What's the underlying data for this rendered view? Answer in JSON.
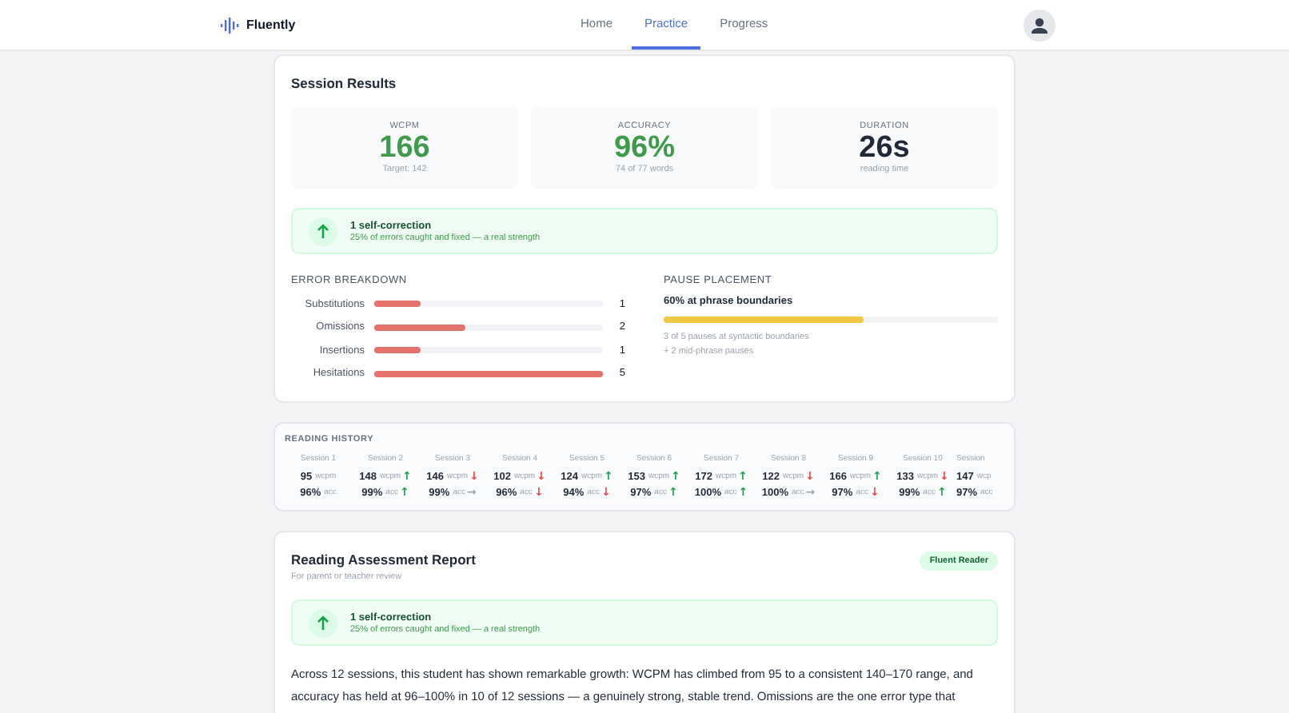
{
  "header": {
    "brand": "Fluently",
    "nav": [
      {
        "label": "Home",
        "selected": false
      },
      {
        "label": "Practice",
        "selected": true
      },
      {
        "label": "Progress",
        "selected": false
      }
    ]
  },
  "session_results": {
    "title": "Session Results",
    "stats": [
      {
        "label": "WCPM",
        "value": "166",
        "note": "Target: 142",
        "kind": "good"
      },
      {
        "label": "ACCURACY",
        "value": "96%",
        "note": "74 of 77 words",
        "kind": "good"
      },
      {
        "label": "DURATION",
        "value": "26s",
        "note": "reading time",
        "kind": "neutral"
      }
    ],
    "callout": {
      "title": "1 self-correction",
      "text": "25% of errors caught and fixed — a real strength"
    },
    "error_breakdown": {
      "title": "ERROR BREAKDOWN",
      "rows": [
        {
          "name": "Substitutions",
          "level": 0.2,
          "count": "1"
        },
        {
          "name": "Omissions",
          "level": 0.4,
          "count": "2"
        },
        {
          "name": "Insertions",
          "level": 0.2,
          "count": "1"
        },
        {
          "name": "Hesitations",
          "level": 1.0,
          "count": "5"
        }
      ]
    },
    "pause_placement": {
      "title": "PAUSE PLACEMENT",
      "headline": "60% at phrase boundaries",
      "level": 0.6,
      "notes": [
        "3 of 5 pauses at syntactic boundaries",
        "+ 2 mid-phrase pauses"
      ]
    }
  },
  "reading_history": {
    "title": "READING HISTORY",
    "sessions": [
      {
        "label": "Session 1",
        "wcpm": "95",
        "wcpm_unit": "wcpm",
        "acc": "96%",
        "acc_unit": "acc"
      },
      {
        "label": "Session 2",
        "wcpm": "148",
        "wcpm_unit": "wcpm",
        "wcpm_change": {
          "arrow": "↑",
          "color": "#16a34a"
        },
        "acc": "99%",
        "acc_unit": "acc",
        "acc_change": {
          "arrow": "↑",
          "color": "#16a34a"
        }
      },
      {
        "label": "Session 3",
        "wcpm": "146",
        "wcpm_unit": "wcpm",
        "wcpm_change": {
          "arrow": "↓",
          "color": "#ef4444"
        },
        "acc": "99%",
        "acc_unit": "acc",
        "acc_change": {
          "arrow": "→",
          "color": "#9ca3af"
        }
      },
      {
        "label": "Session 4",
        "wcpm": "102",
        "wcpm_unit": "wcpm",
        "wcpm_change": {
          "arrow": "↓",
          "color": "#ef4444"
        },
        "acc": "96%",
        "acc_unit": "acc",
        "acc_change": {
          "arrow": "↓",
          "color": "#ef4444"
        }
      },
      {
        "label": "Session 5",
        "wcpm": "124",
        "wcpm_unit": "wcpm",
        "wcpm_change": {
          "arrow": "↑",
          "color": "#16a34a"
        },
        "acc": "94%",
        "acc_unit": "acc",
        "acc_change": {
          "arrow": "↓",
          "color": "#ef4444"
        }
      },
      {
        "label": "Session 6",
        "wcpm": "153",
        "wcpm_unit": "wcpm",
        "wcpm_change": {
          "arrow": "↑",
          "color": "#16a34a"
        },
        "acc": "97%",
        "acc_unit": "acc",
        "acc_change": {
          "arrow": "↑",
          "color": "#16a34a"
        }
      },
      {
        "label": "Session 7",
        "wcpm": "172",
        "wcpm_unit": "wcpm",
        "wcpm_change": {
          "arrow": "↑",
          "color": "#16a34a"
        },
        "acc": "100%",
        "acc_unit": "acc",
        "acc_change": {
          "arrow": "↑",
          "color": "#16a34a"
        }
      },
      {
        "label": "Session 8",
        "wcpm": "122",
        "wcpm_unit": "wcpm",
        "wcpm_change": {
          "arrow": "↓",
          "color": "#ef4444"
        },
        "acc": "100%",
        "acc_unit": "acc",
        "acc_change": {
          "arrow": "→",
          "color": "#9ca3af"
        }
      },
      {
        "label": "Session 9",
        "wcpm": "166",
        "wcpm_unit": "wcpm",
        "wcpm_change": {
          "arrow": "↑",
          "color": "#16a34a"
        },
        "acc": "97%",
        "acc_unit": "acc",
        "acc_change": {
          "arrow": "↓",
          "color": "#ef4444"
        }
      },
      {
        "label": "Session 10",
        "wcpm": "133",
        "wcpm_unit": "wcpm",
        "wcpm_change": {
          "arrow": "↓",
          "color": "#ef4444"
        },
        "acc": "99%",
        "acc_unit": "acc",
        "acc_change": {
          "arrow": "↑",
          "color": "#16a34a"
        }
      },
      {
        "label": "Session",
        "wcpm": "147",
        "wcpm_unit": "wcp",
        "acc": "97%",
        "acc_unit": "acc"
      }
    ]
  },
  "report": {
    "title": "Reading Assessment Report",
    "subtitle": "For parent or teacher review",
    "badge": "Fluent Reader",
    "callout": {
      "title": "1 self-correction",
      "text": "25% of errors caught and fixed — a real strength"
    },
    "paragraph": "Across 12 sessions, this student has shown remarkable growth: WCPM has climbed from 95 to a consistent 140–170 range, and accuracy has held at 96–100% in 10 of 12 sessions — a genuinely strong, stable trend. Omissions are the one error type that"
  }
}
